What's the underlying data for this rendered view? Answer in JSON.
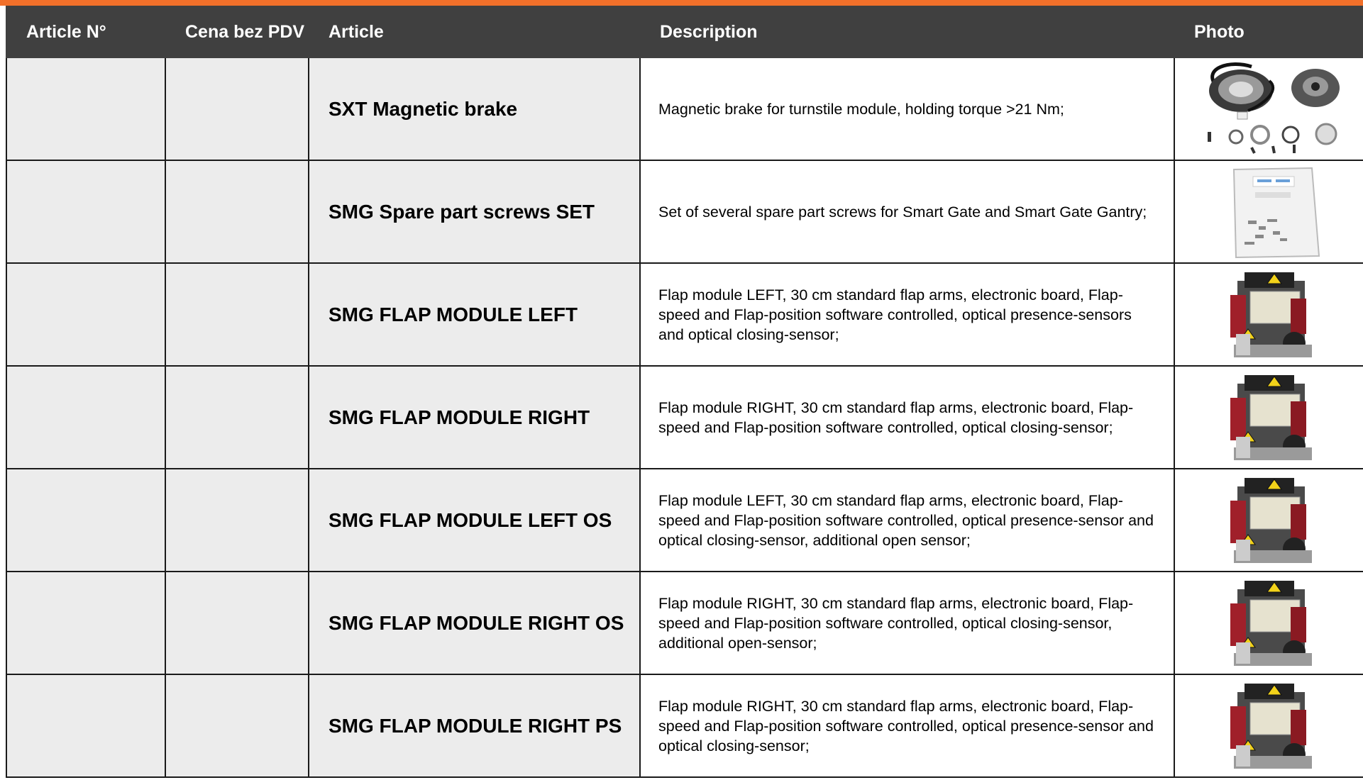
{
  "header": {
    "article_no": "Article N°",
    "price": "Cena bez PDV",
    "article": "Article",
    "description": "Description",
    "photo": "Photo"
  },
  "rows": [
    {
      "article_no": "",
      "price": "",
      "article": "SXT Magnetic brake",
      "description": "Magnetic brake for turnstile module, holding torque >21 Nm;",
      "photo_icon": "magnetic-brake-photo"
    },
    {
      "article_no": "",
      "price": "",
      "article": "SMG Spare part screws SET",
      "description": "Set of several spare part screws for Smart Gate and Smart Gate Gantry;",
      "photo_icon": "screws-bag-photo"
    },
    {
      "article_no": "",
      "price": "",
      "article": "SMG FLAP MODULE LEFT",
      "description": "Flap module LEFT, 30 cm standard flap arms, electronic board, Flap-speed and Flap-position software controlled, optical presence-sensors and optical closing-sensor;",
      "photo_icon": "flap-module-photo"
    },
    {
      "article_no": "",
      "price": "",
      "article": "SMG FLAP MODULE RIGHT",
      "description": "Flap module RIGHT, 30 cm standard flap arms, electronic board, Flap-speed and Flap-position software controlled, optical closing-sensor;",
      "photo_icon": "flap-module-photo"
    },
    {
      "article_no": "",
      "price": "",
      "article": "SMG FLAP MODULE LEFT OS",
      "description": "Flap module LEFT, 30 cm standard flap arms, electronic board, Flap-speed and Flap-position software controlled, optical presence-sensor and optical closing-sensor, additional open sensor;",
      "photo_icon": "flap-module-photo"
    },
    {
      "article_no": "",
      "price": "",
      "article": "SMG FLAP MODULE RIGHT OS",
      "description": "Flap module RIGHT, 30 cm standard flap arms, electronic board, Flap-speed and Flap-position software controlled, optical closing-sensor, additional open-sensor;",
      "photo_icon": "flap-module-photo"
    },
    {
      "article_no": "",
      "price": "",
      "article": "SMG FLAP MODULE RIGHT PS",
      "description": "Flap module RIGHT, 30 cm standard flap arms, electronic board, Flap-speed and Flap-position software controlled, optical presence-sensor and optical closing-sensor;",
      "photo_icon": "flap-module-photo"
    }
  ]
}
